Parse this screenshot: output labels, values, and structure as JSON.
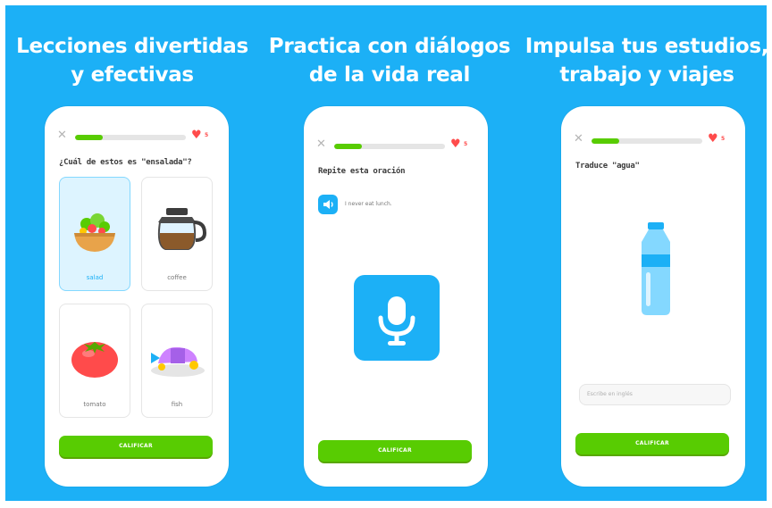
{
  "panels": [
    {
      "headline": "Lecciones divertidas\ny efectivas",
      "hearts": "5",
      "progress": 0.25,
      "prompt": "¿Cuál de estos es \"ensalada\"?",
      "cards": [
        {
          "label": "salad",
          "icon": "salad-bowl-icon",
          "selected": true
        },
        {
          "label": "coffee",
          "icon": "coffee-pot-icon",
          "selected": false
        },
        {
          "label": "tomato",
          "icon": "tomato-icon",
          "selected": false
        },
        {
          "label": "fish",
          "icon": "fish-plate-icon",
          "selected": false
        }
      ],
      "cta": "CALIFICAR"
    },
    {
      "headline": "Practica con diálogos\nde la vida real",
      "hearts": "5",
      "progress": 0.25,
      "prompt": "Repite esta oración",
      "audio_text": "I never eat lunch.",
      "cta": "CALIFICAR"
    },
    {
      "headline": "Impulsa tus estudios,\ntrabajo y viajes",
      "hearts": "5",
      "progress": 0.25,
      "prompt": "Traduce \"agua\"",
      "input_placeholder": "Escribe en inglés",
      "cta": "CALIFICAR"
    }
  ],
  "colors": {
    "background": "#1cb0f6",
    "accent_green": "#58cc02",
    "heart_red": "#ff4b4b",
    "selected_card": "#ddf4ff"
  }
}
